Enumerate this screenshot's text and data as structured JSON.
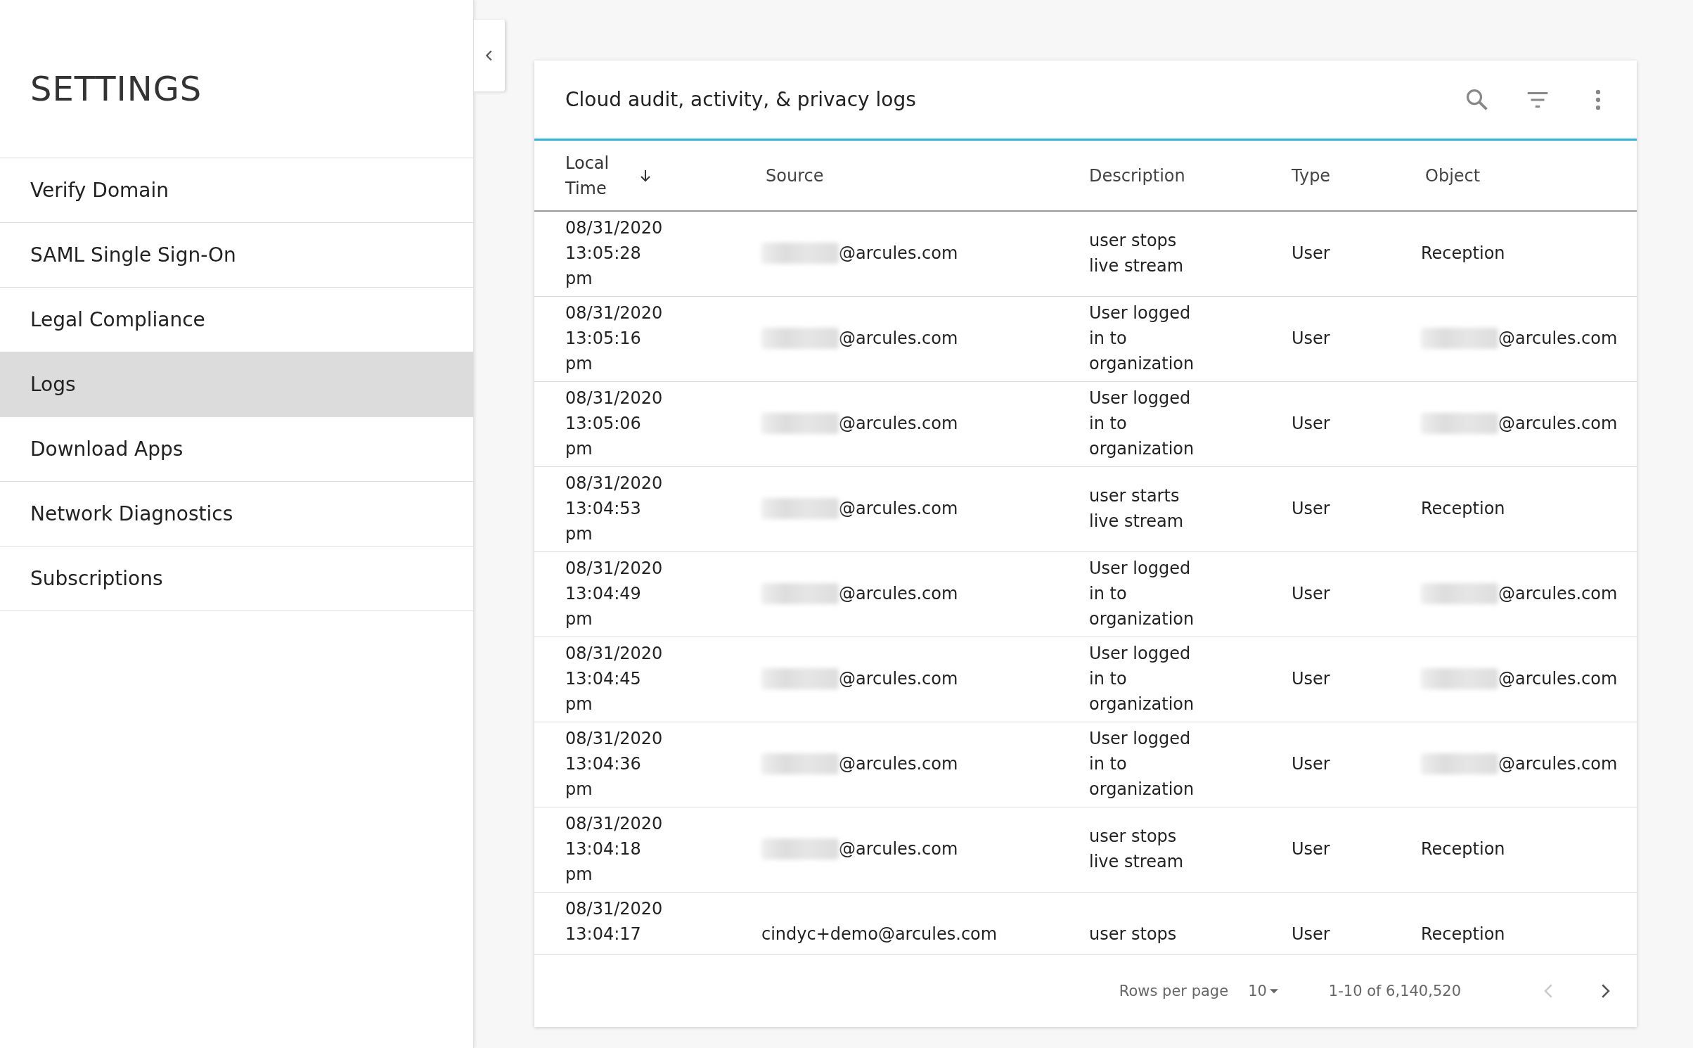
{
  "sidebar": {
    "title": "SETTINGS",
    "items": [
      {
        "label": "Verify Domain",
        "selected": false
      },
      {
        "label": "SAML Single Sign-On",
        "selected": false
      },
      {
        "label": "Legal Compliance",
        "selected": false
      },
      {
        "label": "Logs",
        "selected": true
      },
      {
        "label": "Download Apps",
        "selected": false
      },
      {
        "label": "Network Diagnostics",
        "selected": false
      },
      {
        "label": "Subscriptions",
        "selected": false
      }
    ]
  },
  "card": {
    "title": "Cloud audit, activity, & privacy logs",
    "table": {
      "columns": [
        {
          "label": "Local\nTime",
          "sorted": true
        },
        {
          "label": "Source",
          "sorted": false
        },
        {
          "label": "Description",
          "sorted": false
        },
        {
          "label": "Type",
          "sorted": false
        },
        {
          "label": "Object",
          "sorted": false
        }
      ],
      "rows": [
        {
          "time": "08/31/2020\n13:05:28\npm",
          "source": {
            "text": "@arcules.com",
            "redacted": true
          },
          "description": "user stops\nlive stream",
          "type": "User",
          "object": {
            "text": "Reception"
          }
        },
        {
          "time": "08/31/2020\n13:05:16\npm",
          "source": {
            "text": "@arcules.com",
            "redacted": true
          },
          "description": "User logged\nin to\norganization",
          "type": "User",
          "object": {
            "text": "@arcules.com",
            "redacted": true
          }
        },
        {
          "time": "08/31/2020\n13:05:06\npm",
          "source": {
            "text": "@arcules.com",
            "redacted": true
          },
          "description": "User logged\nin to\norganization",
          "type": "User",
          "object": {
            "text": "@arcules.com",
            "redacted": true
          }
        },
        {
          "time": "08/31/2020\n13:04:53\npm",
          "source": {
            "text": "@arcules.com",
            "redacted": true
          },
          "description": "user starts\nlive stream",
          "type": "User",
          "object": {
            "text": "Reception"
          }
        },
        {
          "time": "08/31/2020\n13:04:49\npm",
          "source": {
            "text": "@arcules.com",
            "redacted": true
          },
          "description": "User logged\nin to\norganization",
          "type": "User",
          "object": {
            "text": "@arcules.com",
            "redacted": true
          }
        },
        {
          "time": "08/31/2020\n13:04:45\npm",
          "source": {
            "text": "@arcules.com",
            "redacted": true
          },
          "description": "User logged\nin to\norganization",
          "type": "User",
          "object": {
            "text": "@arcules.com",
            "redacted": true
          }
        },
        {
          "time": "08/31/2020\n13:04:36\npm",
          "source": {
            "text": "@arcules.com",
            "redacted": true
          },
          "description": "User logged\nin to\norganization",
          "type": "User",
          "object": {
            "text": "@arcules.com",
            "redacted": true
          }
        },
        {
          "time": "08/31/2020\n13:04:18\npm",
          "source": {
            "text": "@arcules.com",
            "redacted": true
          },
          "description": "user stops\nlive stream",
          "type": "User",
          "object": {
            "text": "Reception"
          }
        },
        {
          "time": "08/31/2020\n13:04:17",
          "source": {
            "text": "cindyc+demo@arcules.com"
          },
          "description": "user stops",
          "type": "User",
          "object": {
            "text": "Reception"
          }
        }
      ]
    },
    "pagination": {
      "rows_per_page_label": "Rows per page",
      "rows_per_page": "10",
      "range": "1-10 of 6,140,520",
      "prev_disabled": true,
      "next_disabled": false
    }
  }
}
